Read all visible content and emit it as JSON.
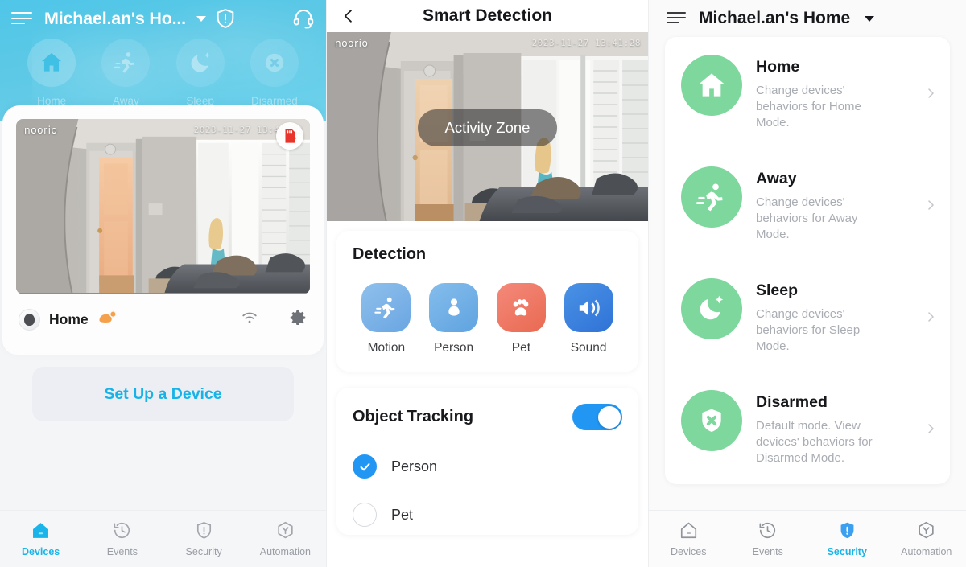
{
  "left_panel": {
    "header": {
      "menu_icon": "hamburger-icon",
      "title": "Michael.an's Ho...",
      "dropdown_icon": "chevron-down-icon",
      "shield_icon": "shield-alert-icon",
      "support_icon": "headset-icon"
    },
    "modes": [
      {
        "label": "Home",
        "icon": "home-icon",
        "active": true
      },
      {
        "label": "Away",
        "icon": "running-icon",
        "active": false
      },
      {
        "label": "Sleep",
        "icon": "moon-icon",
        "active": false
      },
      {
        "label": "Disarmed",
        "icon": "disarmed-icon",
        "active": false
      }
    ],
    "device_card": {
      "camera_brand": "noorio",
      "camera_timestamp": "2023-11-27 13:40:38",
      "sd_badge_icon": "sd-card-error-icon",
      "device_name": "Home",
      "status_icon": "sleep-hand-icon",
      "wifi_icon": "wifi-icon",
      "settings_icon": "gear-icon"
    },
    "setup_button_label": "Set Up a Device",
    "tabs": [
      {
        "label": "Devices",
        "icon": "home-outline-icon",
        "active": true
      },
      {
        "label": "Events",
        "icon": "history-clock-icon",
        "active": false
      },
      {
        "label": "Security",
        "icon": "shield-outline-icon",
        "active": false
      },
      {
        "label": "Automation",
        "icon": "automation-hex-icon",
        "active": false
      }
    ]
  },
  "mid_panel": {
    "header": {
      "back_icon": "back-chevron-icon",
      "title": "Smart Detection"
    },
    "video": {
      "brand": "noorio",
      "timestamp": "2023-11-27 13:41:28",
      "overlay_button_label": "Activity Zone"
    },
    "detection": {
      "title": "Detection",
      "items": [
        {
          "label": "Motion",
          "icon": "motion-running-icon",
          "color": "#7cb4e8"
        },
        {
          "label": "Person",
          "icon": "person-icon",
          "color": "#6fafe4"
        },
        {
          "label": "Pet",
          "icon": "paw-icon",
          "color": "#ef7a62"
        },
        {
          "label": "Sound",
          "icon": "sound-speaker-icon",
          "color": "#3a86e0"
        }
      ]
    },
    "object_tracking": {
      "title": "Object Tracking",
      "toggle_on": true,
      "options": [
        {
          "label": "Person",
          "selected": true
        },
        {
          "label": "Pet",
          "selected": false
        }
      ]
    }
  },
  "right_panel": {
    "header": {
      "menu_icon": "hamburger-icon",
      "title": "Michael.an's Home",
      "dropdown_icon": "chevron-down-icon"
    },
    "modes": [
      {
        "name": "Home",
        "desc": "Change devices' behaviors for Home Mode.",
        "icon": "home-icon"
      },
      {
        "name": "Away",
        "desc": "Change devices' behaviors for Away Mode.",
        "icon": "running-icon"
      },
      {
        "name": "Sleep",
        "desc": "Change devices' behaviors for Sleep Mode.",
        "icon": "moon-icon"
      },
      {
        "name": "Disarmed",
        "desc": "Default mode. View devices' behaviors for Disarmed Mode.",
        "icon": "disarmed-icon"
      }
    ],
    "tabs": [
      {
        "label": "Devices",
        "icon": "home-outline-icon",
        "active": false
      },
      {
        "label": "Events",
        "icon": "history-clock-icon",
        "active": false
      },
      {
        "label": "Security",
        "icon": "shield-filled-icon",
        "active": true
      },
      {
        "label": "Automation",
        "icon": "automation-hex-icon",
        "active": false
      }
    ]
  },
  "colors": {
    "brand_cyan": "#19b5ea",
    "hero_blue": "#57c9e8",
    "mode_green": "#7ed79d",
    "toggle_blue": "#2196f3",
    "pet_orange": "#ef7a62"
  }
}
